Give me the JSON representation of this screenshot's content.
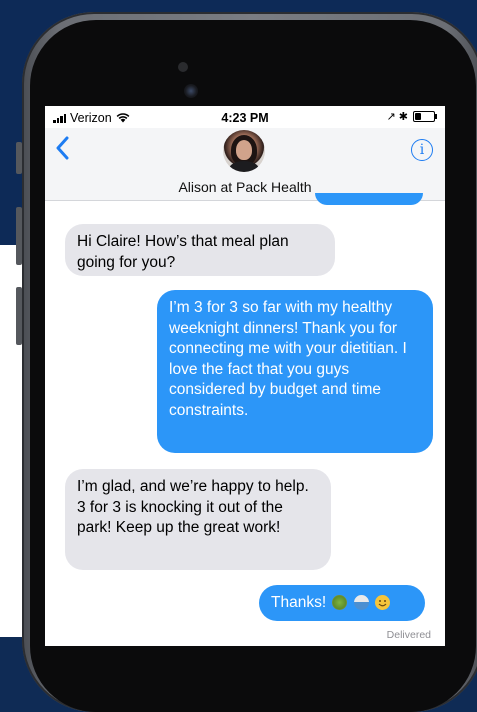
{
  "status_bar": {
    "carrier": "Verizon",
    "time": "4:23 PM",
    "right_symbols": "↗ ✱",
    "battery_level": 0.35
  },
  "header": {
    "contact_name": "Alison at Pack Health",
    "back_symbol": "‹",
    "info_symbol": "i"
  },
  "messages": [
    {
      "direction": "incoming",
      "text": "Hi Claire! How’s that meal plan going for you?"
    },
    {
      "direction": "outgoing",
      "text": "I’m 3 for 3 so far with my healthy weeknight dinners! Thank you for connecting me with your dietitian. I love the fact that you guys considered by budget and time constraints."
    },
    {
      "direction": "incoming",
      "text": "I’m glad, and we’re happy to help. 3 for 3 is knocking it out of the park! Keep up the great work!"
    },
    {
      "direction": "outgoing",
      "text": "Thanks!",
      "emoji_icons": [
        "salad-emoji-icon",
        "bowl-emoji-icon",
        "smiling-face-emoji-icon"
      ]
    }
  ],
  "delivery_status": "Delivered",
  "colors": {
    "outgoing_bubble": "#2c96f8",
    "incoming_bubble": "#e5e5ea",
    "accent": "#1d7cf2",
    "backdrop": "#0d2a57"
  }
}
